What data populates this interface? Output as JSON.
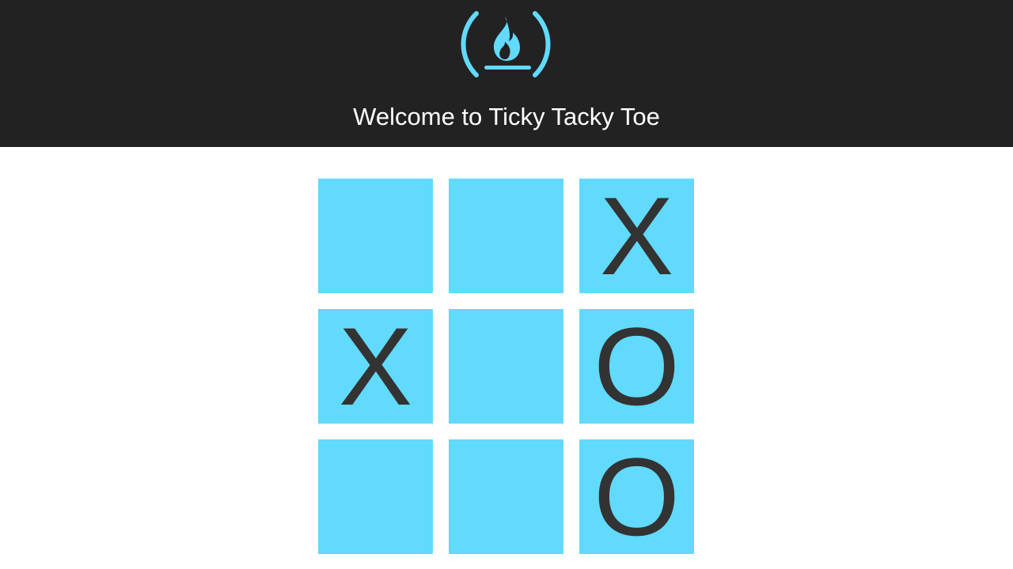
{
  "header": {
    "logo_icon": "freecodecamp-flame-logo",
    "title": "Welcome to Ticky Tacky Toe",
    "background_color": "#222222",
    "accent_color": "#61dafb"
  },
  "board": {
    "cell_color": "#61dafb",
    "mark_color": "#333333",
    "cells": [
      "",
      "",
      "X",
      "X",
      "",
      "O",
      "",
      "",
      "O"
    ]
  }
}
